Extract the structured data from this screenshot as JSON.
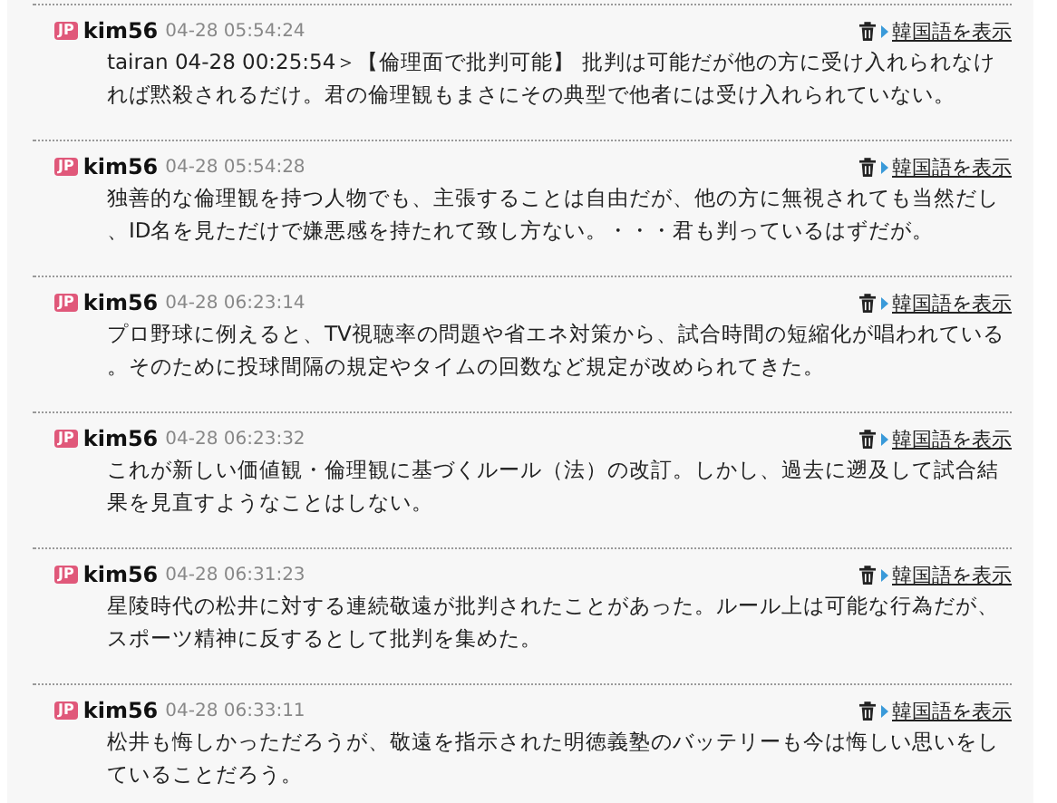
{
  "comments": [
    {
      "country": "JP",
      "user": "kim56",
      "time": "04-28 05:54:24",
      "translate_link": "韓国語を表示",
      "text": "tairan 04-28 00:25:54＞【倫理面で批判可能】 批判は可能だが他の方に受け入れられなければ黙殺されるだけ。君の倫理観もまさにその典型で他者には受け入れられていない。"
    },
    {
      "country": "JP",
      "user": "kim56",
      "time": "04-28 05:54:28",
      "translate_link": "韓国語を表示",
      "text": "独善的な倫理観を持つ人物でも、主張することは自由だが、他の方に無視されても当然だし、ID名を見ただけで嫌悪感を持たれて致し方ない。・・・君も判っているはずだが。"
    },
    {
      "country": "JP",
      "user": "kim56",
      "time": "04-28 06:23:14",
      "translate_link": "韓国語を表示",
      "text": "プロ野球に例えると、TV視聴率の問題や省エネ対策から、試合時間の短縮化が唱われている。そのために投球間隔の規定やタイムの回数など規定が改められてきた。"
    },
    {
      "country": "JP",
      "user": "kim56",
      "time": "04-28 06:23:32",
      "translate_link": "韓国語を表示",
      "text": "これが新しい価値観・倫理観に基づくルール（法）の改訂。しかし、過去に遡及して試合結果を見直すようなことはしない。"
    },
    {
      "country": "JP",
      "user": "kim56",
      "time": "04-28 06:31:23",
      "translate_link": "韓国語を表示",
      "text": "星陵時代の松井に対する連続敬遠が批判されたことがあった。ルール上は可能な行為だが、スポーツ精神に反するとして批判を集めた。"
    },
    {
      "country": "JP",
      "user": "kim56",
      "time": "04-28 06:33:11",
      "translate_link": "韓国語を表示",
      "text": "松井も悔しかっただろうが、敬遠を指示された明徳義塾のバッテリーも今は悔しい思いをしていることだろう。"
    }
  ]
}
